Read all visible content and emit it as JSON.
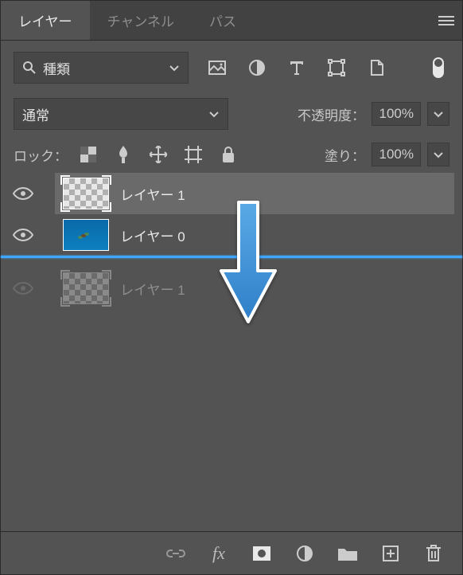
{
  "tabs": {
    "layers": "レイヤー",
    "channels": "チャンネル",
    "paths": "パス"
  },
  "filter": {
    "kind_label": "種類"
  },
  "blend": {
    "mode": "通常",
    "opacity_label": "不透明度：",
    "opacity_value": "100%"
  },
  "lock": {
    "label": "ロック：",
    "fill_label": "塗り：",
    "fill_value": "100%"
  },
  "layers": [
    {
      "name": "レイヤー 1",
      "visible": true,
      "thumb": "checker",
      "selected": true,
      "dim": false
    },
    {
      "name": "レイヤー 0",
      "visible": true,
      "thumb": "ocean",
      "selected": false,
      "dim": false
    },
    {
      "name": "レイヤー 1",
      "visible": false,
      "thumb": "checker",
      "selected": false,
      "dim": true
    }
  ],
  "drop_indicator_after_index": 1
}
